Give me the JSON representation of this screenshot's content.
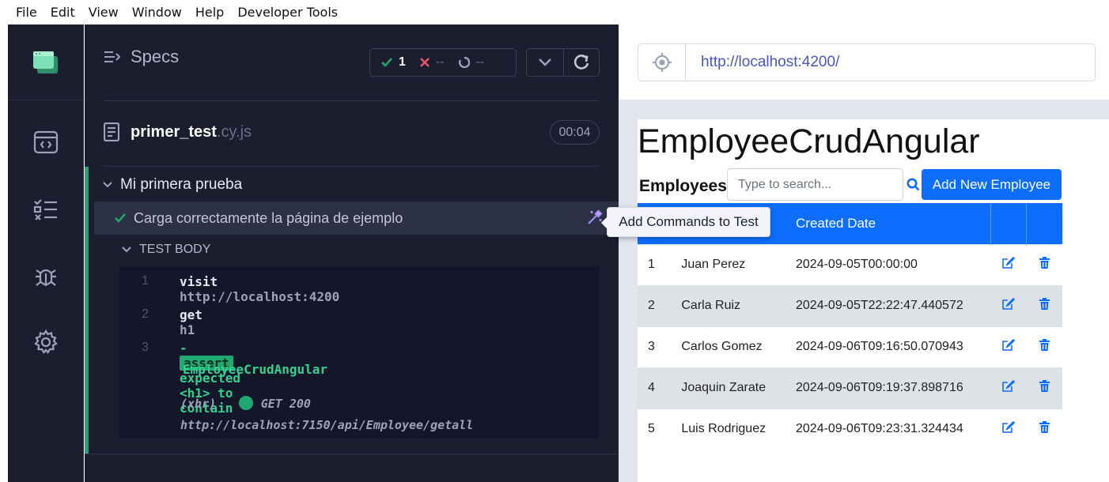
{
  "menu": [
    "File",
    "Edit",
    "View",
    "Window",
    "Help",
    "Developer Tools"
  ],
  "reporter": {
    "header_title": "Specs",
    "stats": {
      "passed": "1",
      "failed": "--",
      "pending": "--"
    },
    "spec": {
      "name": "primer_test",
      "ext": ".cy.js",
      "duration": "00:04"
    },
    "suite_title": "Mi primera prueba",
    "test_title": "Carga correctamente la página de ejemplo",
    "body_title": "TEST BODY",
    "commands": [
      {
        "num": "1",
        "name": "visit",
        "arg": "http://localhost:4200"
      },
      {
        "num": "2",
        "name": "get",
        "arg": "h1"
      },
      {
        "num": "3",
        "dash": "-",
        "badge": "assert",
        "text": "expected <h1> to contain",
        "text2": "EmployeeCrudAngular"
      }
    ],
    "xhr": {
      "label": "(xhr)",
      "method": "GET 200",
      "url": "http://localhost:7150/api/Employee/getall"
    },
    "tooltip": "Add Commands to Test"
  },
  "browser": {
    "url": "http://localhost:4200/"
  },
  "aut": {
    "title": "EmployeeCrudAngular",
    "employees_label": "Employees:",
    "search_placeholder": "Type to search...",
    "add_button": "Add New Employee",
    "columns": [
      "",
      "",
      "Created Date",
      "",
      ""
    ],
    "rows": [
      {
        "id": "1",
        "name": "Juan Perez",
        "date": "2024-09-05T00:00:00"
      },
      {
        "id": "2",
        "name": "Carla Ruiz",
        "date": "2024-09-05T22:22:47.440572"
      },
      {
        "id": "3",
        "name": "Carlos Gomez",
        "date": "2024-09-06T09:16:50.070943"
      },
      {
        "id": "4",
        "name": "Joaquin Zarate",
        "date": "2024-09-06T09:19:37.898716"
      },
      {
        "id": "5",
        "name": "Luis Rodriguez",
        "date": "2024-09-06T09:23:31.324434"
      }
    ]
  },
  "colors": {
    "panel_bg": "#1b1e2e",
    "pass_green": "#1fa971",
    "fail_red": "#e45770",
    "primary_blue": "#0d6efd"
  },
  "icons": [
    "cypress-logo-icon",
    "browser-icon",
    "list-icon",
    "bug-icon",
    "gear-icon",
    "specs-icon",
    "check-icon",
    "x-icon",
    "spinner-icon",
    "chevron-down-icon",
    "refresh-icon",
    "file-icon",
    "magic-wand-icon",
    "crosshair-icon",
    "search-icon",
    "edit-icon",
    "trash-icon"
  ]
}
